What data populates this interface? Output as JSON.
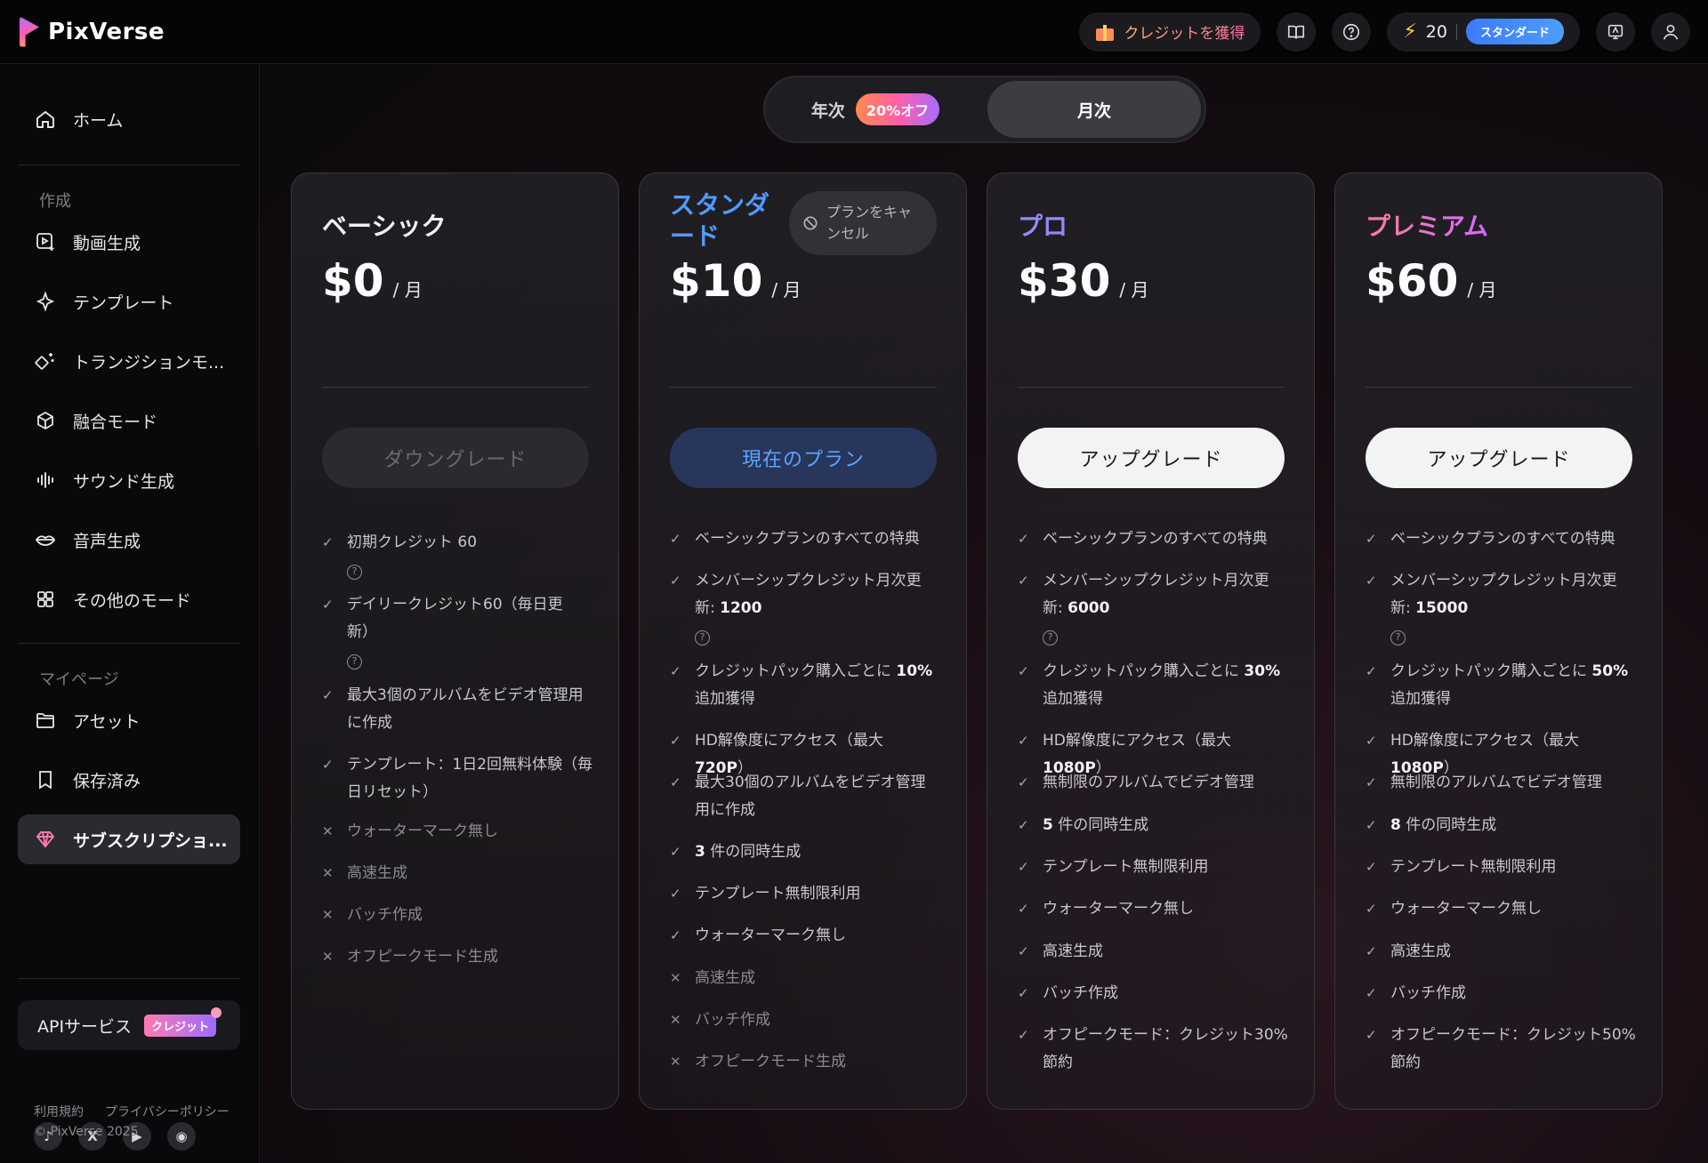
{
  "app": {
    "name": "PixVerse"
  },
  "topbar": {
    "earn_label": "クレジットを獲得",
    "credits": "20",
    "plan_badge": "スタンダード",
    "icons": [
      "gift-icon",
      "book-icon",
      "help-icon",
      "bolt-icon",
      "feedback-icon",
      "user-icon"
    ]
  },
  "sidebar": {
    "home": "ホーム",
    "section_create": "作成",
    "create_items": [
      {
        "label": "動画生成",
        "icon": "video-plus-icon"
      },
      {
        "label": "テンプレート",
        "icon": "sparkle-icon"
      },
      {
        "label": "トランジションモ...",
        "icon": "magic-wand-icon"
      },
      {
        "label": "融合モード",
        "icon": "cube-icon"
      },
      {
        "label": "サウンド生成",
        "icon": "sound-wave-icon"
      },
      {
        "label": "音声生成",
        "icon": "lips-icon"
      },
      {
        "label": "その他のモード",
        "icon": "grid-icon"
      }
    ],
    "section_mypage": "マイページ",
    "mypage_items": [
      {
        "label": "アセット",
        "icon": "folder-icon"
      },
      {
        "label": "保存済み",
        "icon": "bookmark-icon"
      },
      {
        "label": "サブスクリプショ...",
        "icon": "diamond-icon"
      }
    ],
    "api_label": "APIサービス",
    "api_badge": "クレジット",
    "social": [
      {
        "name": "tiktok",
        "glyph": "♪"
      },
      {
        "name": "x",
        "glyph": "X"
      },
      {
        "name": "youtube",
        "glyph": "▶"
      },
      {
        "name": "discord",
        "glyph": "◉"
      }
    ],
    "terms": "利用規約",
    "privacy": "プライバシーポリシー",
    "copyright": "© PixVerse 2025"
  },
  "billing_toggle": {
    "annual": "年次",
    "discount": "20%オフ",
    "monthly": "月次",
    "selected": "monthly"
  },
  "plans": [
    {
      "name": "ベーシック",
      "price": "$0",
      "period": "/ 月",
      "cta": "ダウングレード",
      "features": [
        {
          "ok": true,
          "text": "初期クレジット 60",
          "help": true
        },
        {
          "ok": true,
          "text": "デイリークレジット60（毎日更",
          "text2": "新）",
          "help": true
        },
        {
          "ok": true,
          "text": "最大3個のアルバムをビデオ管理用",
          "text2": "に作成"
        },
        {
          "ok": true,
          "text": "テンプレート：1日2回無料体験（毎",
          "text2": "日リセット）"
        },
        {
          "ok": false,
          "text": "ウォーターマーク無し"
        },
        {
          "ok": false,
          "text": "高速生成"
        },
        {
          "ok": false,
          "text": "バッチ作成"
        },
        {
          "ok": false,
          "text": "オフピークモード生成"
        }
      ]
    },
    {
      "name_line1": "スタンダ",
      "name_line2": "ード",
      "price": "$10",
      "period": "/ 月",
      "cancel_line1": "プランをキャ",
      "cancel_line2": "ンセル",
      "cta": "現在のプラン",
      "features": [
        {
          "ok": true,
          "text": "ベーシックプランのすべての特典"
        },
        {
          "ok": true,
          "text": "メンバーシップクレジット月次更",
          "text2_plain": "新: ",
          "text2_bold": "1200",
          "help": true
        },
        {
          "ok": true,
          "text_plain": "クレジットパック購入ごとに ",
          "text_bold": "10%",
          "text2": "追加獲得"
        },
        {
          "ok": true,
          "text_plain": "HD解像度にアクセス（最大 ",
          "text_bold": "720P",
          "text_tail": "）"
        },
        {
          "ok": true,
          "text": "最大30個のアルバムをビデオ管理",
          "text2": "用に作成"
        },
        {
          "ok": true,
          "text_bold": "3",
          "text_tail": " 件の同時生成"
        },
        {
          "ok": true,
          "text": "テンプレート無制限利用"
        },
        {
          "ok": true,
          "text": "ウォーターマーク無し"
        },
        {
          "ok": false,
          "text": "高速生成"
        },
        {
          "ok": false,
          "text": "バッチ作成"
        },
        {
          "ok": false,
          "text": "オフピークモード生成"
        }
      ]
    },
    {
      "name": "プロ",
      "price": "$30",
      "period": "/ 月",
      "cta": "アップグレード",
      "features": [
        {
          "ok": true,
          "text": "ベーシックプランのすべての特典"
        },
        {
          "ok": true,
          "text": "メンバーシップクレジット月次更",
          "text2_plain": "新: ",
          "text2_bold": "6000",
          "help": true
        },
        {
          "ok": true,
          "text_plain": "クレジットパック購入ごとに ",
          "text_bold": "30%",
          "text2": "追加獲得"
        },
        {
          "ok": true,
          "text_plain": "HD解像度にアクセス（最大 ",
          "text_bold": "1080P",
          "text_tail": "）"
        },
        {
          "ok": true,
          "text": "無制限のアルバムでビデオ管理"
        },
        {
          "ok": true,
          "text_bold": "5",
          "text_tail": " 件の同時生成"
        },
        {
          "ok": true,
          "text": "テンプレート無制限利用"
        },
        {
          "ok": true,
          "text": "ウォーターマーク無し"
        },
        {
          "ok": true,
          "text": "高速生成"
        },
        {
          "ok": true,
          "text": "バッチ作成"
        },
        {
          "ok": true,
          "text": "オフピークモード：クレジット30%",
          "text2": "節約"
        }
      ]
    },
    {
      "name": "プレミアム",
      "price": "$60",
      "period": "/ 月",
      "cta": "アップグレード",
      "features": [
        {
          "ok": true,
          "text": "ベーシックプランのすべての特典"
        },
        {
          "ok": true,
          "text": "メンバーシップクレジット月次更",
          "text2_plain": "新: ",
          "text2_bold": "15000",
          "help": true
        },
        {
          "ok": true,
          "text_plain": "クレジットパック購入ごとに ",
          "text_bold": "50%",
          "text2": "追加獲得"
        },
        {
          "ok": true,
          "text_plain": "HD解像度にアクセス（最大 ",
          "text_bold": "1080P",
          "text_tail": "）"
        },
        {
          "ok": true,
          "text": "無制限のアルバムでビデオ管理"
        },
        {
          "ok": true,
          "text_bold": "8",
          "text_tail": " 件の同時生成"
        },
        {
          "ok": true,
          "text": "テンプレート無制限利用"
        },
        {
          "ok": true,
          "text": "ウォーターマーク無し"
        },
        {
          "ok": true,
          "text": "高速生成"
        },
        {
          "ok": true,
          "text": "バッチ作成"
        },
        {
          "ok": true,
          "text": "オフピークモード：クレジット50%",
          "text2": "節約"
        }
      ]
    }
  ]
}
